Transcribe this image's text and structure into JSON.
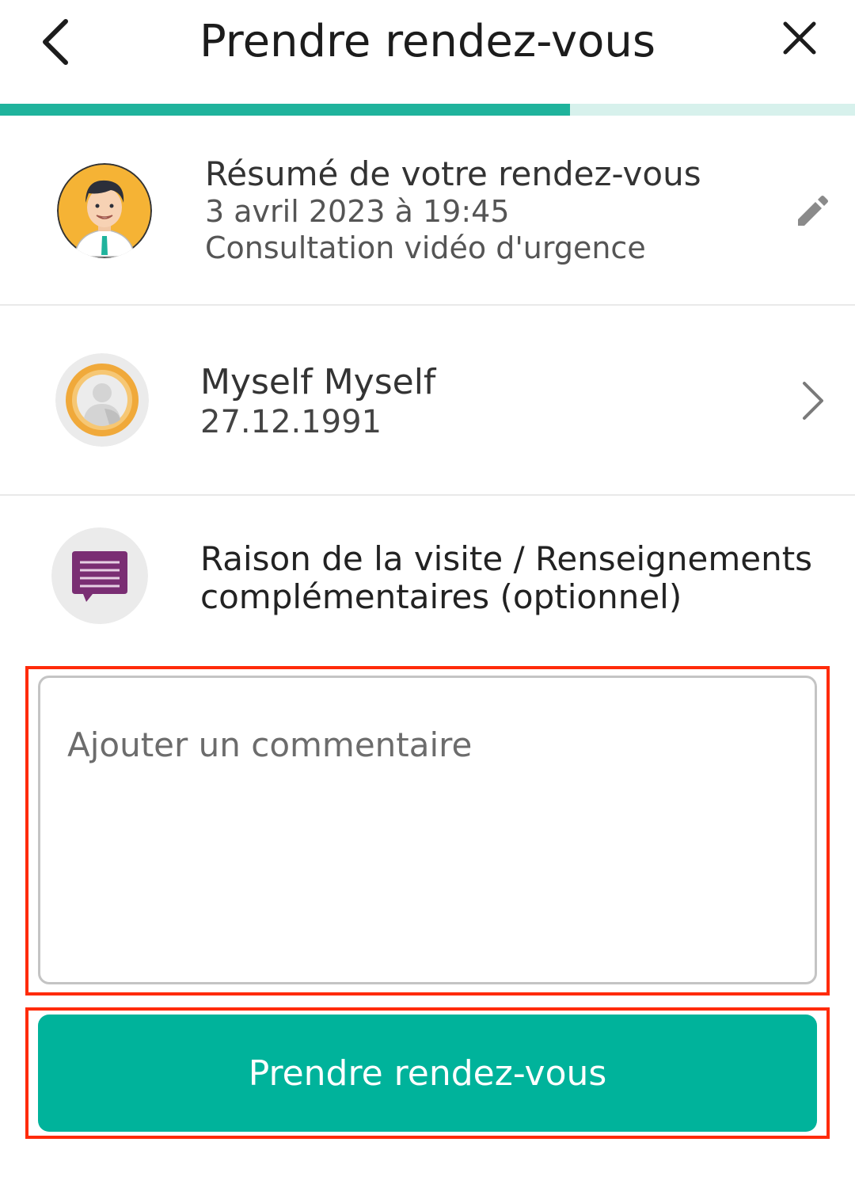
{
  "header": {
    "title": "Prendre rendez-vous",
    "back_icon": "chevron-left-icon",
    "close_icon": "close-icon"
  },
  "progress": {
    "value": 0.667
  },
  "summary": {
    "heading": "Résumé de votre rendez-vous",
    "datetime": "3 avril 2023 à 19:45",
    "type": "Consultation vidéo d'urgence",
    "edit_icon": "pencil-icon"
  },
  "patient": {
    "name": "Myself Myself",
    "birthdate": "27.12.1991",
    "chevron_icon": "chevron-right-icon"
  },
  "reason": {
    "label_line1": "Raison de la visite / Renseignements",
    "label_line2": "complémentaires (optionnel)",
    "icon": "message-icon"
  },
  "comment": {
    "placeholder": "Ajouter un commentaire",
    "value": ""
  },
  "cta": {
    "label": "Prendre rendez-vous"
  },
  "colors": {
    "accent": "#00b39b",
    "progress_track": "#d7f1ec",
    "highlight": "#ff2b0a",
    "message_icon": "#7a2e73",
    "avatar_orange": "#f5b335"
  }
}
